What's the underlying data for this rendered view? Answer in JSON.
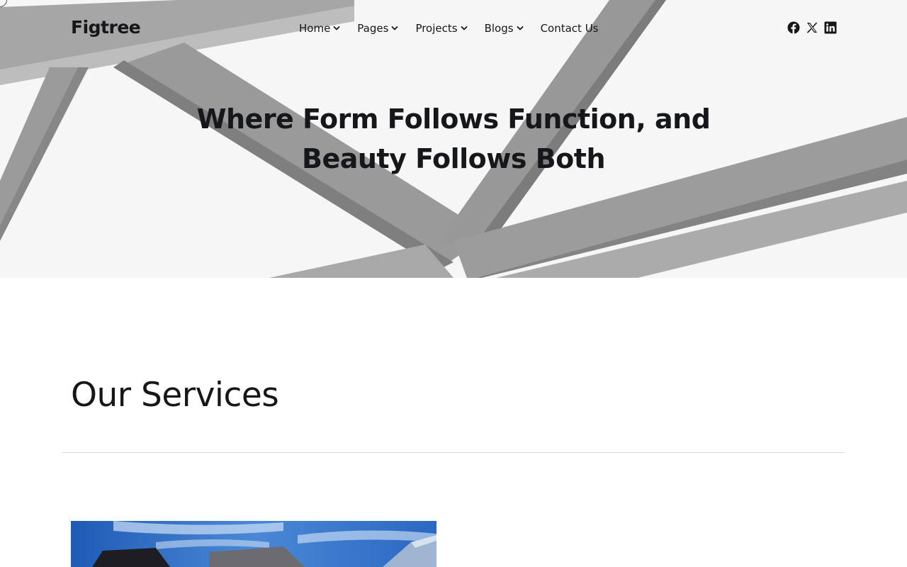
{
  "brand": {
    "name": "Figtree"
  },
  "nav": {
    "items": [
      {
        "label": "Home",
        "has_dropdown": true
      },
      {
        "label": "Pages",
        "has_dropdown": true
      },
      {
        "label": "Projects",
        "has_dropdown": true
      },
      {
        "label": "Blogs",
        "has_dropdown": true
      },
      {
        "label": "Contact Us",
        "has_dropdown": false
      }
    ]
  },
  "social": {
    "icons": [
      "facebook-icon",
      "x-twitter-icon",
      "linkedin-icon"
    ]
  },
  "hero": {
    "title_line1": "Where Form Follows Function, and",
    "title_line2": "Beauty Follows Both",
    "image": "architectural-wooden-beams-grayscale"
  },
  "services": {
    "title": "Our Services",
    "first_image": "modern-building-blue-sky"
  },
  "colors": {
    "text": "#15171a",
    "divider": "#dcdcdc",
    "hero_background": "#f4f4f4",
    "sky_blue": "#2f6fc4"
  }
}
